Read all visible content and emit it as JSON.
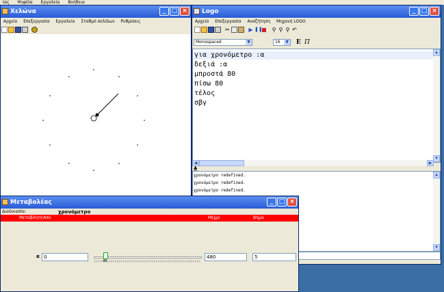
{
  "top_menu": [
    "ίας",
    "Ψηφίδα",
    "Εργαλεία",
    "Βοήθεια"
  ],
  "turtle_window": {
    "title": "Χελώνα",
    "menu": [
      "Αρχείο",
      "Επεξεργασία",
      "Εργαλεία",
      "Σταθμό σελίδων",
      "Ρυθμίσεις"
    ]
  },
  "logo_window": {
    "title": "Logo",
    "menu": [
      "Αρχείο",
      "Επεξεργασία",
      "Αναζήτηση",
      "Μηχανή LOGO"
    ],
    "font_name": "Monospaced",
    "font_size": "16",
    "bold_label": "E",
    "italic_label": "Π",
    "code_lines": [
      "για χρονόμετρο :α",
      "δεξιά :α",
      "μπροστά 80",
      "πίσω 80",
      "τέλος",
      "σβγ"
    ],
    "output_lines": [
      "χρονόμετρο redefined.",
      "χρονόμετρο redefined.",
      "χρονόμετρο redefined."
    ]
  },
  "variables_window": {
    "title": "Μεταβολέας",
    "procedure_label": "Διαδικασία:",
    "procedure_name": "χρονόμετρο",
    "columns": {
      "variable": "Μεταβλητή",
      "from": "Από",
      "to": "Μέχρι",
      "step": "Βήμα"
    },
    "variable_name": "α",
    "from_value": "0",
    "slider_value": "45",
    "to_value": "480",
    "step_value": "5",
    "slider_fraction": 0.094
  },
  "colors": {
    "title_blue": "#2a5bd7",
    "close_red": "#e0503c",
    "header_red": "#ff0000",
    "desktop": "#3a6ea5"
  }
}
